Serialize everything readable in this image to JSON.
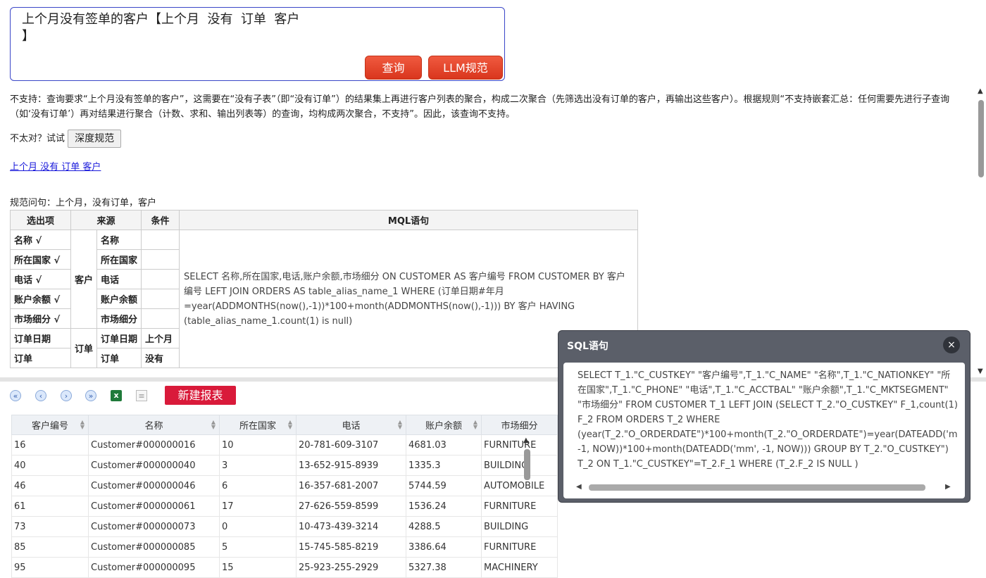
{
  "query": {
    "text": "上个月没有签单的客户【上个月  没有  订单  客户\n】",
    "query_button": "查询",
    "llm_button": "LLM规范"
  },
  "notice": "不支持：查询要求“上个月没有签单的客户”，这需要在“没有子表”（即“没有订单”）的结果集上再进行客户列表的聚合，构成二次聚合（先筛选出没有订单的客户，再输出这些客户）。根据规则“不支持嵌套汇总：任何需要先进行子查询（如‘没有订单’）再对结果进行聚合（计数、求和、输出列表等）的查询，均构成两次聚合，不支持”。因此，该查询不支持。",
  "retry": {
    "prefix": "不太对？试试",
    "button": "深度规范"
  },
  "suggestion_link": "上个月 没有 订单 客户",
  "normalized": "规范问句：上个月，没有订单，客户",
  "mql_table": {
    "headers": [
      "选出项",
      "来源",
      "条件",
      "MQL语句"
    ],
    "rows": [
      {
        "select": "名称 √",
        "source": "名称",
        "cond": ""
      },
      {
        "select": "所在国家 √",
        "source": "所在国家",
        "cond": ""
      },
      {
        "select": "电话 √",
        "source": "电话",
        "cond": ""
      },
      {
        "select": "账户余额 √",
        "source": "账户余额",
        "cond": ""
      },
      {
        "select": "市场细分 √",
        "source": "市场细分",
        "cond": ""
      },
      {
        "select": "订单日期",
        "source": "订单日期",
        "cond": "上个月"
      },
      {
        "select": "订单",
        "source": "订单",
        "cond": "没有"
      }
    ],
    "group_customer": "客户",
    "group_order": "订单",
    "mql": "SELECT 名称,所在国家,电话,账户余额,市场细分 ON CUSTOMER AS 客户编号 FROM CUSTOMER BY 客户编号 LEFT JOIN ORDERS AS table_alias_name_1 WHERE (订单日期#年月 =year(ADDMONTHS(now(),-1))*100+month(ADDMONTHS(now(),-1))) BY 客户 HAVING (table_alias_name_1.count(1) is null)"
  },
  "toolbar": {
    "new_report": "新建报表"
  },
  "grid": {
    "headers": [
      "客户编号",
      "名称",
      "所在国家",
      "电话",
      "账户余额",
      "市场细分"
    ],
    "rows": [
      [
        "16",
        "Customer#000000016",
        "10",
        "20-781-609-3107",
        "4681.03",
        "FURNITURE"
      ],
      [
        "40",
        "Customer#000000040",
        "3",
        "13-652-915-8939",
        "1335.3",
        "BUILDING"
      ],
      [
        "46",
        "Customer#000000046",
        "6",
        "16-357-681-2007",
        "5744.59",
        "AUTOMOBILE"
      ],
      [
        "61",
        "Customer#000000061",
        "17",
        "27-626-559-8599",
        "1536.24",
        "FURNITURE"
      ],
      [
        "73",
        "Customer#000000073",
        "0",
        "10-473-439-3214",
        "4288.5",
        "BUILDING"
      ],
      [
        "85",
        "Customer#000000085",
        "5",
        "15-745-585-8219",
        "3386.64",
        "FURNITURE"
      ],
      [
        "95",
        "Customer#000000095",
        "15",
        "25-923-255-2929",
        "5327.38",
        "MACHINERY"
      ]
    ]
  },
  "sql_dialog": {
    "title": "SQL语句",
    "close": "×",
    "sql": "SELECT T_1.\"C_CUSTKEY\" \"客户编号\",T_1.\"C_NAME\" \"名称\",T_1.\"C_NATIONKEY\" \"所在国家\",T_1.\"C_PHONE\" \"电话\",T_1.\"C_ACCTBAL\" \"账户余额\",T_1.\"C_MKTSEGMENT\" \"市场细分\" FROM CUSTOMER T_1 LEFT JOIN (SELECT T_2.\"O_CUSTKEY\" F_1,count(1) F_2 FROM ORDERS T_2 WHERE (year(T_2.\"O_ORDERDATE\")*100+month(T_2.\"O_ORDERDATE\")=year(DATEADD('mm', -1, NOW))*100+month(DATEADD('mm', -1, NOW))) GROUP BY T_2.\"O_CUSTKEY\") T_2 ON T_1.\"C_CUSTKEY\"=T_2.F_1 WHERE (T_2.F_2 IS NULL )"
  }
}
